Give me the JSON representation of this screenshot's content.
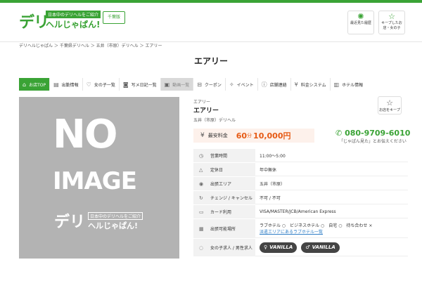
{
  "header": {
    "logo_big": "デリ",
    "logo_tag": "日本中のデリヘルをご紹介",
    "logo_sub": "ヘルじゃぱん!",
    "region": "千葉版",
    "icons": [
      {
        "name": "browsing-history",
        "icon": "sun-icon",
        "label": "最近見た履歴"
      },
      {
        "name": "kept-shops",
        "icon": "star-icon",
        "label": "キープしたお店・女の子"
      }
    ]
  },
  "breadcrumb": "デリヘルじゃぱん ＞ 千葉県デリヘル ＞ 五井（市原）デリヘル ＞ エアリー",
  "page_title": "エアリー",
  "nav": [
    {
      "name": "shop-top",
      "icon": "home-icon",
      "label": "お店TOP",
      "state": "active"
    },
    {
      "name": "work-diary",
      "icon": "document-icon",
      "label": "出勤情報",
      "state": "normal"
    },
    {
      "name": "girls-list",
      "icon": "heart-icon",
      "label": "女の子一覧",
      "state": "normal"
    },
    {
      "name": "photo-diary",
      "icon": "camera-icon",
      "label": "写メ日記一覧",
      "state": "normal"
    },
    {
      "name": "video-list",
      "icon": "video-icon",
      "label": "動画一覧",
      "state": "disabled"
    },
    {
      "name": "coupon",
      "icon": "ticket-icon",
      "label": "クーポン",
      "state": "normal"
    },
    {
      "name": "event",
      "icon": "party-icon",
      "label": "イベント",
      "state": "normal"
    },
    {
      "name": "shop-contact",
      "icon": "info-icon",
      "label": "店舗連絡",
      "state": "normal"
    },
    {
      "name": "price-system",
      "icon": "yen-icon",
      "label": "料金システム",
      "state": "normal"
    },
    {
      "name": "hotel-info",
      "icon": "hotel-icon",
      "label": "ホテル情報",
      "state": "normal"
    }
  ],
  "noimage": {
    "line1": "NO",
    "line2": "IMAGE",
    "logo_big": "デリ",
    "logo_tag": "日本中のデリヘルをご紹介",
    "logo_sub": "ヘルじゃぱん!"
  },
  "shop": {
    "kana": "エアリー",
    "name": "エアリー",
    "area": "五井（市原）デリヘル",
    "keep_label": "お店をキープ",
    "price_label": "最安料金",
    "price_minutes": "60",
    "price_unit": "分",
    "price_value": "10,000円",
    "phone": "080-9709-6010",
    "phone_note": "「じゃぱん見た」とお伝えください"
  },
  "info": [
    {
      "icon": "clock-icon",
      "key": "営業時間",
      "values": [
        "11:00～5:00"
      ]
    },
    {
      "icon": "warning-icon",
      "key": "定休日",
      "values": [
        "年中無休"
      ]
    },
    {
      "icon": "pin-icon",
      "key": "出張エリア",
      "values": [
        "五井（市原）"
      ]
    },
    {
      "icon": "refresh-icon",
      "key": "チェンジ / キャンセル",
      "values": [
        "不可 / 不可"
      ]
    },
    {
      "icon": "card-icon",
      "key": "カード利用",
      "values": [
        "VISA/MASTER/JCB/American Express"
      ]
    },
    {
      "icon": "building-icon",
      "key": "出張可能場所",
      "values": [
        "ラブホテル ○　ビジネスホテル ○　自宅 ○　待ち合わせ ×"
      ],
      "link": "派遣エリアにあるラブホテル一覧"
    },
    {
      "icon": "chat-icon",
      "key": "女の子求人 / 男性求人",
      "badges": [
        "VANILLA",
        "VANILLA"
      ]
    }
  ]
}
